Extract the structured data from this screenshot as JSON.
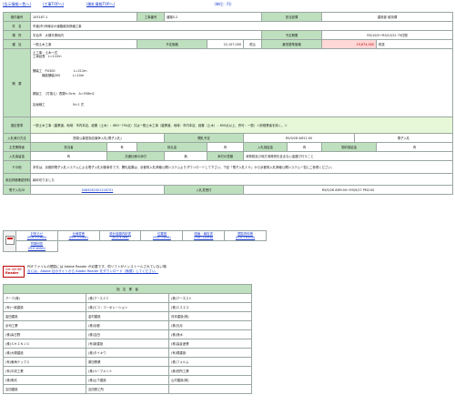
{
  "top_links": {
    "list": "(告示情報一覧へ)",
    "top": "(工事TOPへ)",
    "precedence": "(開札情報TOPへ)",
    "unit": "（単位：円）"
  },
  "rows": {
    "r1": {
      "h1": "案件番号",
      "v1": "105187-1",
      "h2": "工事番号",
      "v2": "道路5-2",
      "h3": "担当部課",
      "v3": "建設部 維持課"
    },
    "r2": {
      "h1": "件　名",
      "v1": "市道(市)号線ほか道路維持修繕工事"
    },
    "r3": {
      "h1": "場　所",
      "v1": "宇治市　大槻平周地内",
      "h2": "予定期間",
      "v2": "R5/10/5～R5/12/22 79日間"
    },
    "r4": {
      "h1": "種　目",
      "v1": "一般土木工事",
      "h2": "予定価格",
      "v2": "22,107,000",
      "h3": "税込",
      "h4": "最低基準価格",
      "v4": "19,874,000",
      "h5": "税抜"
    },
    "overview": {
      "label": "概　要",
      "lines": [
        "土工事：土木一式",
        "工事延長　L=122ｍ",
        "",
        "",
        "",
        "舗装工　PU300　　　　　　L=212ｍ",
        "　　　機能舗装300　　　　L=14ｍ",
        "",
        "",
        "",
        "",
        "鋼製工　（打換え）表層t=5cm　A=558ｍ2",
        "",
        "",
        "区画線工　　　　　　　　　N=1 式"
      ]
    },
    "qual": {
      "h1": "選定基準",
      "v1": "一般土木工事（農業道、地域：市内本店、経審（土木）：680~790点）又は一般土木工事（農業道、地域：市内本店、経審（土木）：800点以上、許可：一般）＜耐候業者を除く。＞"
    },
    "r6": {
      "h1": "入札執行方法",
      "v1": "簡易公募型指名競争入札(電子入札)",
      "h2": "開札予定",
      "v2": "R5/9/28 AM11:00",
      "v3": "電子入札"
    },
    "r7": {
      "h1": "主任業務者",
      "v1": "担当者",
      "v2": "有",
      "h3": "前払金",
      "v3": "有",
      "h4": "入札保証金",
      "v4": "有",
      "h5": "契約保証金",
      "v5": "有"
    },
    "r8": {
      "h1": "入札保留金",
      "v1": "有",
      "h2": "共通仕様の添付",
      "v2": "無",
      "h3": "添付の書類",
      "v3": "",
      "v4": "消費税及び地方消費税を含まない金額で行うこと"
    },
    "r9": {
      "h1": "その他",
      "v1": "本件は、京都府電子入札システムによる電子入札対象事件です。開札結果は、京都府入札情報公開システムよりダウンロードして下さい。下記「電子入札ＩＤ」から京都府入札情報公開システム一覧にご参照ください。"
    },
    "r10": {
      "h1": "参加資格確認資料",
      "v1": "締め切りました"
    },
    "r11": {
      "h1": "電子入札ID",
      "v1": "0464262301218701",
      "h2": "入札書受付",
      "v2": "R5/9/26 AM9:00～R5/9/27 PM2:00"
    }
  },
  "downloads": [
    {
      "title": "お知らせ",
      "size": "(PDF:103KB)"
    },
    {
      "title": "仕様書等",
      "size": "(PDF:233KB)"
    },
    {
      "title": "設計金額内訳書",
      "size": "(XLS:43KB)"
    },
    {
      "title": "位置図",
      "size": "(PDF:15MB)"
    },
    {
      "title": "図面・報告書",
      "size": "(PDF:120KB)"
    },
    {
      "title": "閲覧資料等",
      "size": "(PDF:165KB)"
    },
    {
      "title": "質疑回答",
      "size": "(PDF:60KB)"
    }
  ],
  "reader": {
    "badge_top": "Get ADOBE",
    "badge_main": "Reader",
    "line1": "PDFファイルの閲覧には Adobe Reader が必要です。同ソフトがインストールされていない場",
    "line2": "合には、Adobe 社のサイトから Adobe Reader をダウンロード（無償）してください。"
  },
  "bidders": {
    "header": "指　名　業　者",
    "rows": [
      [
        "アーク(株)",
        "(株)アースＺＩ",
        "(株)アーネスト"
      ],
      [
        "(有)一誠建設",
        "(株)エコ・コーポレーション",
        "(株)エスエス"
      ],
      [
        "金田建設",
        "金村建設",
        "河本建設(株)"
      ],
      [
        "京司工業",
        "(株)京都",
        "(株)光月"
      ],
      [
        "(株)喜日野",
        "(株)吉田",
        "(株)清水"
      ],
      [
        "(株)ＳＨＩＮＪＯ",
        "(有)新建設",
        "(株)高倉産業"
      ],
      [
        "(株)大陽建設",
        "(株)タイキウ",
        "(有)橘建設"
      ],
      [
        "(有)東海テックス",
        "原田興業",
        "(株)フォルム"
      ],
      [
        "(有)平成工業",
        "(株)ペーブメント",
        "(株)別所工業"
      ],
      [
        "(株)明光",
        "(株)山下建設",
        "山村建設(株)"
      ],
      [
        "吉田建設",
        "吉田鉄工所",
        ""
      ]
    ]
  }
}
